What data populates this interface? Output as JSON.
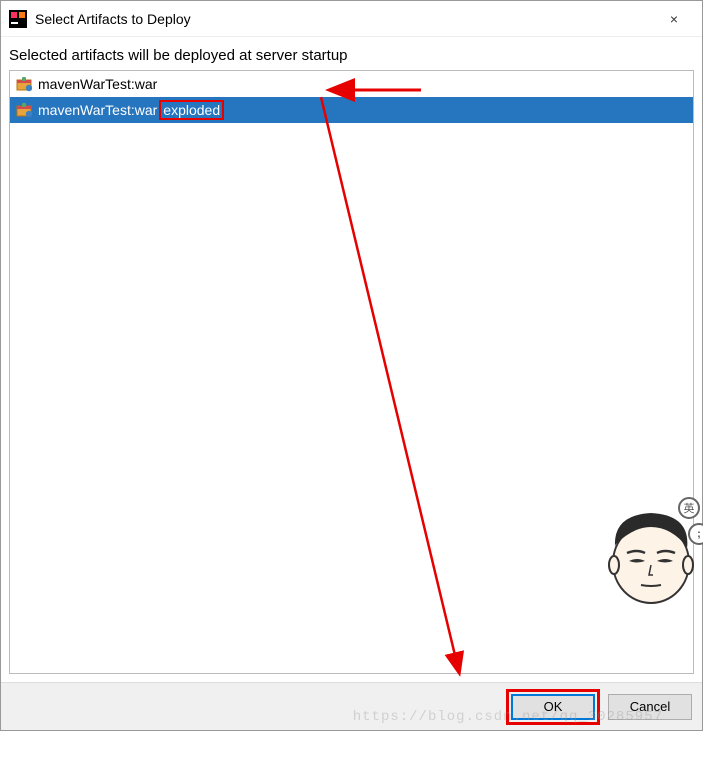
{
  "titlebar": {
    "title": "Select Artifacts to Deploy",
    "close_label": "×"
  },
  "instruction": "Selected artifacts will be deployed at server startup",
  "artifacts": [
    {
      "label": "mavenWarTest:war",
      "selected": false
    },
    {
      "label_prefix": "mavenWarTest:war",
      "label_suffix": "exploded",
      "selected": true
    }
  ],
  "buttons": {
    "ok": "OK",
    "cancel": "Cancel"
  },
  "badge_text": "英",
  "watermark": "https://blog.csdn.net/qq_30285957"
}
